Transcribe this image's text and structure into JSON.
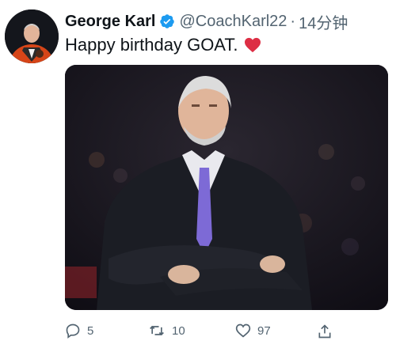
{
  "tweet": {
    "author_name": "George Karl",
    "handle": "@CoachKarl22",
    "separator": "·",
    "time": "14分钟",
    "text": "Happy birthday GOAT.",
    "emoji": "heart-emoji"
  },
  "actions": {
    "replies": "5",
    "retweets": "10",
    "likes": "97"
  },
  "colors": {
    "text": "#0f1419",
    "secondary": "#536471",
    "verified": "#1d9bf0",
    "heart": "#e0245e"
  },
  "icons": [
    "verified-badge-icon",
    "reply-icon",
    "retweet-icon",
    "like-icon",
    "share-icon"
  ]
}
